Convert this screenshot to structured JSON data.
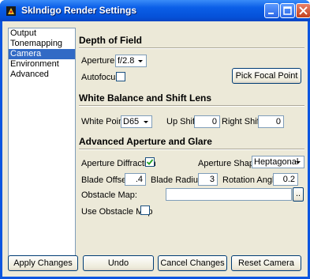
{
  "window": {
    "title": "SkIndigo Render Settings"
  },
  "sidebar": {
    "items": [
      {
        "label": "Output",
        "selected": false
      },
      {
        "label": "Tonemapping",
        "selected": false
      },
      {
        "label": "Camera",
        "selected": true
      },
      {
        "label": "Environment",
        "selected": false
      },
      {
        "label": "Advanced",
        "selected": false
      }
    ]
  },
  "depth_of_field": {
    "title": "Depth of Field",
    "aperture_label": "Aperture:",
    "aperture_value": "f/2.8",
    "autofocus_label": "Autofocus",
    "autofocus_checked": false,
    "pick_focal_button": "Pick Focal Point"
  },
  "white_balance": {
    "title": "White Balance and Shift Lens",
    "white_point_label": "White Point:",
    "white_point_value": "D65",
    "up_shift_label": "Up Shift:",
    "up_shift_value": "0",
    "right_shift_label": "Right Shift:",
    "right_shift_value": "0"
  },
  "advanced_aperture": {
    "title": "Advanced Aperture and Glare",
    "diffraction_label": "Aperture Diffraction",
    "diffraction_checked": true,
    "shape_label": "Aperture Shape:",
    "shape_value": "Heptagonal",
    "blade_offset_label": "Blade Offset:",
    "blade_offset_value": ".4",
    "blade_radius_label": "Blade Radius:",
    "blade_radius_value": "3",
    "rotation_label": "Rotation Angle:",
    "rotation_value": "0.2",
    "obstacle_map_label": "Obstacle Map:",
    "obstacle_map_value": "",
    "browse_button": "..",
    "use_obstacle_label": "Use Obstacle Map",
    "use_obstacle_checked": false
  },
  "footer": {
    "apply_button": "Apply Changes",
    "undo_button": "Undo",
    "cancel_button": "Cancel Changes",
    "reset_button": "Reset Camera"
  }
}
